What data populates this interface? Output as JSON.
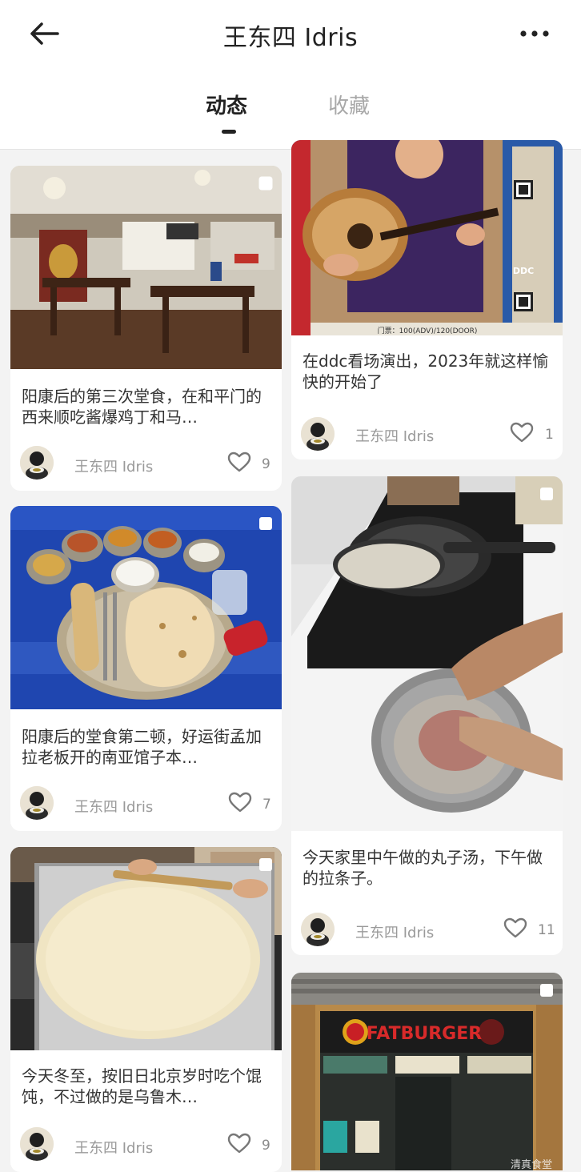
{
  "header": {
    "title": "王东四 Idris",
    "back_icon": "arrow-left-icon",
    "more_icon": "more-horizontal-icon"
  },
  "tabs": [
    {
      "label": "动态",
      "active": true
    },
    {
      "label": "收藏",
      "active": false
    }
  ],
  "posts": [
    {
      "caption": "阳康后的第三次堂食，在和平门的西来顺吃酱爆鸡丁和马…",
      "author": "王东四 Idris",
      "likes": "9",
      "image": "restaurant dining room"
    },
    {
      "caption": "阳康后的堂食第二顿，好运街孟加拉老板开的南亚馆子本…",
      "author": "王东四 Idris",
      "likes": "7",
      "image": "south asian thali and naan"
    },
    {
      "caption": "今天冬至，按旧日北京岁时吃个馄饨，不过做的是乌鲁木…",
      "author": "王东四 Idris",
      "likes": "9",
      "image": "rolling dough sheet"
    },
    {
      "caption": "在ddc看场演出，2023年就这样愉快的开始了",
      "author": "王东四 Idris",
      "likes": "1",
      "image": "oud player poster",
      "poster_text": "门票：100(ADV)/120(DOOR)",
      "poster_logo": "DDC"
    },
    {
      "caption": "今天家里中午做的丸子汤，下午做的拉条子。",
      "author": "王东四 Idris",
      "likes": "11",
      "image": "frying pan and mixing bowl"
    },
    {
      "caption": "",
      "author": "",
      "likes": "",
      "image": "fatburger storefront",
      "sign_text": "FATBURGER",
      "watermark": "清真食堂"
    }
  ],
  "colors": {
    "accent": "#222222",
    "inactive_tab": "#a8a8a8",
    "background": "#f3f3f3"
  }
}
